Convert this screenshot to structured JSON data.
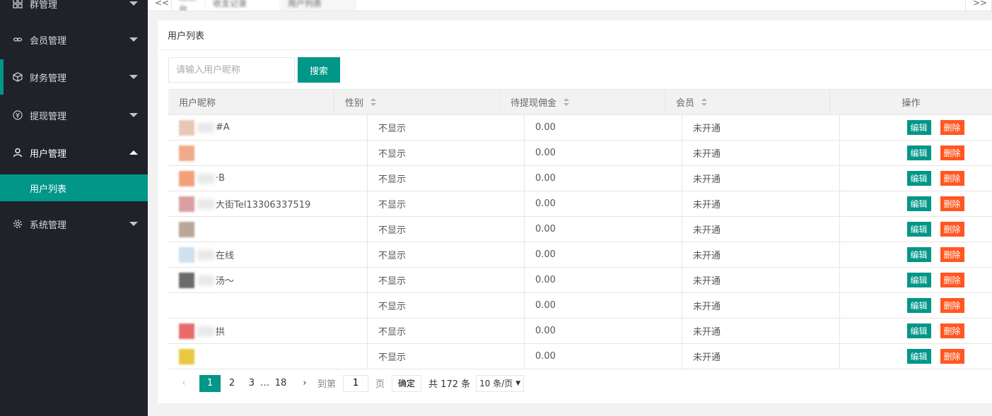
{
  "sidebar": {
    "items": [
      {
        "label": "群管理"
      },
      {
        "label": "会员管理"
      },
      {
        "label": "财务管理"
      },
      {
        "label": "提现管理"
      },
      {
        "label": "用户管理"
      },
      {
        "label": "系统管理"
      }
    ],
    "sub_item": {
      "label": "用户列表"
    }
  },
  "tabs": {
    "items": [
      {
        "label": "<<"
      },
      {
        "label": "控制台"
      },
      {
        "label": "收支记录"
      },
      {
        "label": "用户列表"
      },
      {
        "label": ">>"
      }
    ]
  },
  "card": {
    "title": "用户列表"
  },
  "search": {
    "placeholder": "请输入用户昵称",
    "button": "搜索"
  },
  "table": {
    "columns": [
      "用户昵称",
      "性别",
      "待提现佣金",
      "会员",
      "操作"
    ],
    "rows": [
      {
        "nick": "#A",
        "gender": "不显示",
        "amount": "0.00",
        "member": "未开通"
      },
      {
        "nick": "",
        "gender": "不显示",
        "amount": "0.00",
        "member": "未开通"
      },
      {
        "nick": "·B",
        "gender": "不显示",
        "amount": "0.00",
        "member": "未开通"
      },
      {
        "nick": "大街Tel13306337519",
        "gender": "不显示",
        "amount": "0.00",
        "member": "未开通"
      },
      {
        "nick": "",
        "gender": "不显示",
        "amount": "0.00",
        "member": "未开通"
      },
      {
        "nick": "在线",
        "gender": "不显示",
        "amount": "0.00",
        "member": "未开通"
      },
      {
        "nick": "汤～",
        "gender": "不显示",
        "amount": "0.00",
        "member": "未开通"
      },
      {
        "nick": "",
        "gender": "不显示",
        "amount": "0.00",
        "member": "未开通"
      },
      {
        "nick": "拱",
        "gender": "不显示",
        "amount": "0.00",
        "member": "未开通"
      },
      {
        "nick": "",
        "gender": "不显示",
        "amount": "0.00",
        "member": "未开通"
      }
    ],
    "edit_label": "编辑",
    "delete_label": "删除"
  },
  "pagination": {
    "pages": [
      "1",
      "2",
      "3",
      "…",
      "18"
    ],
    "goto_label": "到第",
    "goto_value": "1",
    "page_unit": "页",
    "confirm": "确定",
    "total": "共 172 条",
    "page_size": "10 条/页"
  },
  "colors": {
    "primary": "#009688",
    "danger": "#ff5722",
    "sidebar": "#20222a"
  }
}
